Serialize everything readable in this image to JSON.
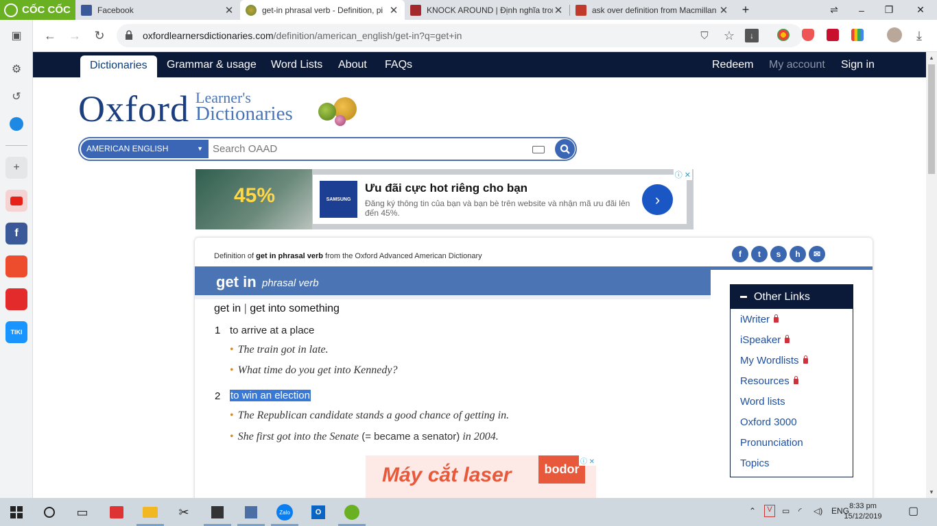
{
  "browser": {
    "brand": "CỐC CỐC",
    "tabs": [
      {
        "title": "Facebook"
      },
      {
        "title": "get-in phrasal verb - Definition, pi"
      },
      {
        "title": "KNOCK AROUND | Định nghĩa tron"
      },
      {
        "title": "ask over definition from Macmillan"
      }
    ],
    "url_host": "oxfordlearnersdictionaries.com",
    "url_path": "/definition/american_english/get-in?q=get+in"
  },
  "site_nav": {
    "left": [
      "Dictionaries",
      "Grammar & usage",
      "Word Lists",
      "About",
      "FAQs"
    ],
    "right": [
      "Redeem",
      "My account",
      "Sign in"
    ]
  },
  "logo": {
    "name": "Oxford",
    "line1": "Learner's",
    "line2": "Dictionaries"
  },
  "search": {
    "dialect": "AMERICAN ENGLISH",
    "placeholder": "Search OAAD"
  },
  "ad_top": {
    "percent": "45%",
    "brand": "SAMSUNG",
    "headline": "Ưu đãi cực hot riêng cho bạn",
    "body": "Đăng ký thông tin của bạn và bạn bè trên website và nhận mã ưu đãi lên đến 45%."
  },
  "entry": {
    "source_prefix": "Definition of ",
    "source_bold": "get in phrasal verb",
    "source_suffix": " from the Oxford Advanced American Dictionary",
    "headword": "get in",
    "pos": "phrasal verb",
    "form1": "get in",
    "form2": "get into something",
    "senses": [
      {
        "num": "1",
        "def": "to arrive at a place",
        "examples": [
          "The train got in late.",
          "What time do you get into Kennedy?"
        ]
      },
      {
        "num": "2",
        "def": "to win an election",
        "examples": [
          "The Republican candidate stands a good chance of getting in."
        ],
        "example2_pre": "She first got into the Senate",
        "example2_gloss": " (= became a senator) ",
        "example2_post": "in 2004."
      }
    ]
  },
  "other_links": {
    "title": "Other Links",
    "items": [
      "iWriter",
      "iSpeaker",
      "My Wordlists",
      "Resources",
      "Word lists",
      "Oxford 3000",
      "Pronunciation",
      "Topics"
    ]
  },
  "ad_bottom": {
    "text": "Máy cắt laser",
    "brand": "bodor"
  },
  "taskbar": {
    "lang": "ENG",
    "time": "8:33 pm",
    "date": "15/12/2019"
  },
  "colors": {
    "nav_bg": "#0c1a3a",
    "accent": "#4a74b4",
    "link": "#1e4f9c",
    "highlight": "#3a78d6"
  }
}
